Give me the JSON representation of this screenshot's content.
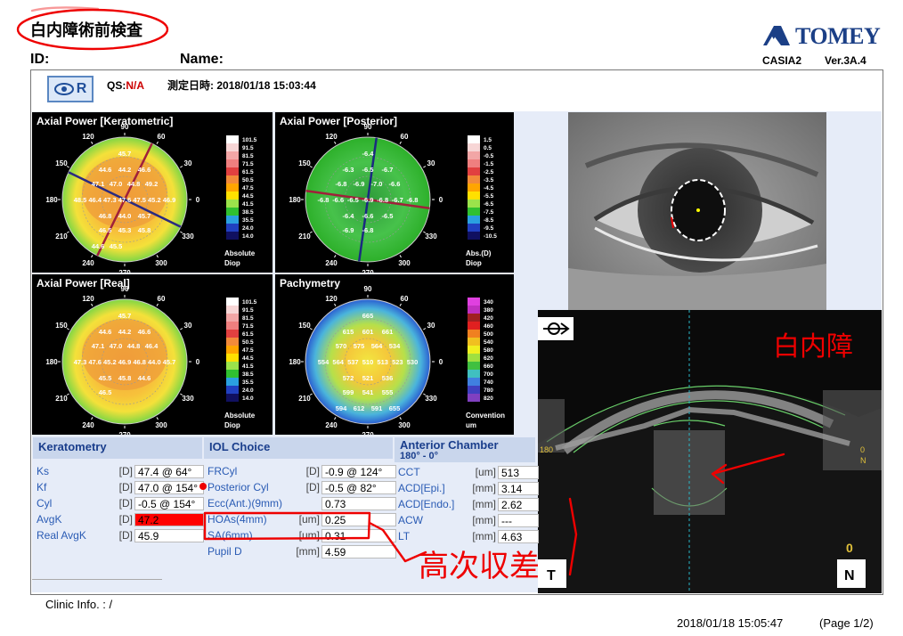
{
  "header": {
    "title": "白内障術前検査",
    "id_label": "ID:",
    "name_label": "Name:",
    "brand": "TOMEY",
    "model": "CASIA2",
    "version": "Ver.3A.4",
    "eye": "R",
    "qs_label": "QS:",
    "qs_value": "N/A",
    "measure_datetime_label": "測定日時:",
    "measure_datetime": "2018/01/18 15:03:44"
  },
  "maps": [
    {
      "title": "Axial Power [Keratometric]",
      "scale": [
        "101.5",
        "91.5",
        "81.5",
        "71.5",
        "61.5",
        "50.5",
        "47.5",
        "44.5",
        "41.5",
        "38.5",
        "35.5",
        "24.0",
        "14.0"
      ],
      "unit1": "Absolute",
      "unit2": "Diop",
      "values": [
        "45.7",
        "44.6",
        "44.2",
        "46.6",
        "47.1",
        "47.0",
        "44.8",
        "49.2",
        "48.5",
        "46.4",
        "47.3",
        "47.6",
        "47.5",
        "45.2",
        "46.9",
        "46.8",
        "44.0",
        "45.7",
        "46.5",
        "45.3",
        "45.8",
        "44.6",
        "45.5"
      ]
    },
    {
      "title": "Axial Power [Posterior]",
      "scale": [
        "1.5",
        "0.5",
        "-0.5",
        "-1.5",
        "-2.5",
        "-3.5",
        "-4.5",
        "-5.5",
        "-6.5",
        "-7.5",
        "-8.5",
        "-9.5",
        "-10.5"
      ],
      "unit1": "Abs.(D)",
      "unit2": "Diop",
      "values": [
        "-6.4",
        "-6.3",
        "-6.5",
        "-6.7",
        "-6.8",
        "-6.9",
        "-7.0",
        "-6.6",
        "-6.8",
        "-6.6",
        "-6.5",
        "-6.9",
        "-6.8",
        "-6.7",
        "-6.8",
        "-6.4",
        "-6.6",
        "-6.5",
        "-6.9",
        "-6.8"
      ]
    },
    {
      "title": "Axial Power [Real]",
      "scale": [
        "101.5",
        "91.5",
        "81.5",
        "71.5",
        "61.5",
        "50.5",
        "47.5",
        "44.5",
        "41.5",
        "38.5",
        "35.5",
        "24.0",
        "14.0"
      ],
      "unit1": "Absolute",
      "unit2": "Diop",
      "values": [
        "45.7",
        "44.6",
        "44.2",
        "46.6",
        "47.1",
        "47.0",
        "44.8",
        "46.4",
        "47.3",
        "47.6",
        "45.2",
        "46.9",
        "46.8",
        "44.0",
        "45.7",
        "45.5",
        "45.8",
        "44.6",
        "46.5"
      ]
    },
    {
      "title": "Pachymetry",
      "scale": [
        "340",
        "380",
        "420",
        "460",
        "500",
        "540",
        "580",
        "620",
        "660",
        "700",
        "740",
        "780",
        "820"
      ],
      "unit1": "Convention",
      "unit2": "um",
      "values": [
        "665",
        "615",
        "601",
        "661",
        "570",
        "575",
        "564",
        "534",
        "554",
        "564",
        "537",
        "510",
        "513",
        "523",
        "530",
        "572",
        "521",
        "536",
        "599",
        "541",
        "555",
        "594",
        "612",
        "591",
        "655"
      ]
    }
  ],
  "axis_labels": [
    "90",
    "120",
    "60",
    "150",
    "30",
    "180",
    "0",
    "210",
    "330",
    "240",
    "300",
    "270"
  ],
  "oct": {
    "left_label": "180",
    "right_label": "0",
    "right_letter": "N",
    "corner_num": "0",
    "corner_box": "N",
    "left_box": "T"
  },
  "keratometry": {
    "title": "Keratometry",
    "rows": [
      {
        "label": "Ks",
        "unit": "[D]",
        "value": "47.4 @ 64°"
      },
      {
        "label": "Kf",
        "unit": "[D]",
        "value": "47.0 @ 154°"
      },
      {
        "label": "Cyl",
        "unit": "[D]",
        "value": "-0.5 @ 154°"
      },
      {
        "label": "AvgK",
        "unit": "[D]",
        "value": "47.2"
      },
      {
        "label": "Real AvgK",
        "unit": "[D]",
        "value": "45.9"
      }
    ]
  },
  "iol": {
    "title": "IOL Choice",
    "rows": [
      {
        "label": "FRCyl",
        "unit": "[D]",
        "value": "-0.9 @ 124°"
      },
      {
        "label": "Posterior Cyl",
        "unit": "[D]",
        "value": "-0.5 @ 82°"
      },
      {
        "label": "Ecc(Ant.)(9mm)",
        "unit": "",
        "value": "0.73"
      },
      {
        "label": "HOAs(4mm)",
        "unit": "[um]",
        "value": "0.25"
      },
      {
        "label": "SA(6mm)",
        "unit": "[um]",
        "value": "0.31"
      },
      {
        "label": "Pupil D",
        "unit": "[mm]",
        "value": "4.59"
      }
    ]
  },
  "anterior": {
    "title": "Anterior Chamber",
    "subtitle": "180° - 0°",
    "rows": [
      {
        "label": "CCT",
        "unit": "[um]",
        "value": "513"
      },
      {
        "label": "ACD[Epi.]",
        "unit": "[mm]",
        "value": "3.14"
      },
      {
        "label": "ACD[Endo.]",
        "unit": "[mm]",
        "value": "2.62"
      },
      {
        "label": "ACW",
        "unit": "[mm]",
        "value": "---"
      },
      {
        "label": "LT",
        "unit": "[mm]",
        "value": "4.63"
      }
    ]
  },
  "footer": {
    "clinic_info": "Clinic Info. :   /",
    "datetime": "2018/01/18 15:05:47",
    "page": "(Page 1/2)"
  },
  "annotations": {
    "cataract": "白内障",
    "hoa": "高次収差"
  },
  "colors": {
    "avgk_highlight": "#ff0000",
    "header_bg": "#c9d6ec",
    "label_blue": "#2a5bb4",
    "red_ink": "#e00000",
    "brand_blue": "#1b3f86"
  }
}
